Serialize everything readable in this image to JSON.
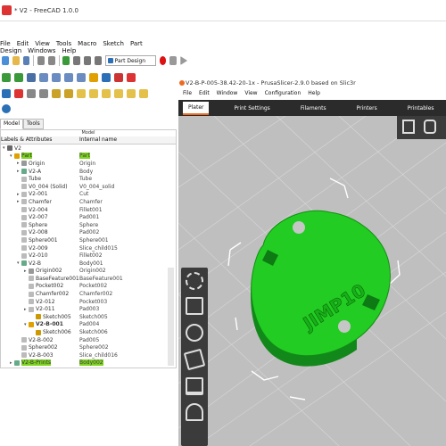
{
  "freecad": {
    "title": "* V2 - FreeCAD 1.0.0",
    "menu": [
      "File",
      "Edit",
      "View",
      "Tools",
      "Macro",
      "Sketch",
      "Part Design",
      "Windows",
      "Help"
    ],
    "workbench": "Part Design",
    "tabs": [
      "Model",
      "Tools"
    ],
    "panel_header": "Model",
    "columns": [
      "Labels & Attributes",
      "Internal name"
    ],
    "tree": [
      {
        "label": "V2",
        "internal": "",
        "depth": 0,
        "arrow": "▾",
        "color": "#666"
      },
      {
        "label": "Part",
        "internal": "Part",
        "depth": 1,
        "arrow": "▾",
        "color": "#e0a000",
        "hl": true
      },
      {
        "label": "Origin",
        "internal": "Origin",
        "depth": 2,
        "arrow": "▸",
        "color": "#999"
      },
      {
        "label": "V2-A",
        "internal": "Body",
        "depth": 2,
        "arrow": "▸",
        "color": "#6a8"
      },
      {
        "label": "Tube",
        "internal": "Tube",
        "depth": 2,
        "arrow": "",
        "color": "#bbb"
      },
      {
        "label": "V0_004 (Solid)",
        "internal": "V0_004_solid",
        "depth": 2,
        "arrow": "",
        "color": "#bbb"
      },
      {
        "label": "V2-001",
        "internal": "Cut",
        "depth": 2,
        "arrow": "▸",
        "color": "#bbb"
      },
      {
        "label": "Chamfer",
        "internal": "Chamfer",
        "depth": 2,
        "arrow": "▸",
        "color": "#bbb"
      },
      {
        "label": "V2-004",
        "internal": "Fillet001",
        "depth": 2,
        "arrow": "",
        "color": "#bbb"
      },
      {
        "label": "V2-007",
        "internal": "Pad001",
        "depth": 2,
        "arrow": "",
        "color": "#bbb"
      },
      {
        "label": "Sphere",
        "internal": "Sphere",
        "depth": 2,
        "arrow": "",
        "color": "#bbb"
      },
      {
        "label": "V2-008",
        "internal": "Pad002",
        "depth": 2,
        "arrow": "",
        "color": "#bbb"
      },
      {
        "label": "Sphere001",
        "internal": "Sphere001",
        "depth": 2,
        "arrow": "",
        "color": "#bbb"
      },
      {
        "label": "V2-009",
        "internal": "Slice_child015",
        "depth": 2,
        "arrow": "",
        "color": "#bbb"
      },
      {
        "label": "V2-010",
        "internal": "Fillet002",
        "depth": 2,
        "arrow": "",
        "color": "#bbb"
      },
      {
        "label": "V2-B",
        "internal": "Body001",
        "depth": 2,
        "arrow": "▾",
        "color": "#6a8"
      },
      {
        "label": "Origin002",
        "internal": "Origin002",
        "depth": 3,
        "arrow": "▸",
        "color": "#999"
      },
      {
        "label": "BaseFeature001",
        "internal": "BaseFeature001",
        "depth": 3,
        "arrow": "",
        "color": "#bbb"
      },
      {
        "label": "Pocket002",
        "internal": "Pocket002",
        "depth": 3,
        "arrow": "",
        "color": "#bbb"
      },
      {
        "label": "Chamfer002",
        "internal": "Chamfer002",
        "depth": 3,
        "arrow": "",
        "color": "#bbb"
      },
      {
        "label": "V2-012",
        "internal": "Pocket003",
        "depth": 3,
        "arrow": "",
        "color": "#bbb"
      },
      {
        "label": "V2-011",
        "internal": "Pad003",
        "depth": 3,
        "arrow": "▸",
        "color": "#bbb"
      },
      {
        "label": "Sketch005",
        "internal": "Sketch005",
        "depth": 4,
        "arrow": "",
        "color": "#c90"
      },
      {
        "label": "V2-B-001",
        "internal": "Pad004",
        "depth": 3,
        "arrow": "▾",
        "color": "#e0a000",
        "bold": true
      },
      {
        "label": "Sketch006",
        "internal": "Sketch006",
        "depth": 4,
        "arrow": "",
        "color": "#c90"
      },
      {
        "label": "V2-B-002",
        "internal": "Pad005",
        "depth": 2,
        "arrow": "",
        "color": "#bbb"
      },
      {
        "label": "Sphere002",
        "internal": "Sphere002",
        "depth": 2,
        "arrow": "",
        "color": "#bbb"
      },
      {
        "label": "V2-B-003",
        "internal": "Slice_child016",
        "depth": 2,
        "arrow": "",
        "color": "#bbb"
      },
      {
        "label": "V2-B-Prints",
        "internal": "Body002",
        "depth": 1,
        "arrow": "▸",
        "color": "#6a8",
        "hl": true
      }
    ]
  },
  "prusa": {
    "title": "V2-B-P-005-38.42-20-1x - PrusaSlicer-2.9.0 based on Slic3r",
    "menu": [
      "File",
      "Edit",
      "Window",
      "View",
      "Configuration",
      "Help"
    ],
    "tabs": [
      "Plater",
      "Print Settings",
      "Filaments",
      "Printers",
      "Printables"
    ],
    "model_text": "JIMP10",
    "model_color": "#22cc22"
  }
}
